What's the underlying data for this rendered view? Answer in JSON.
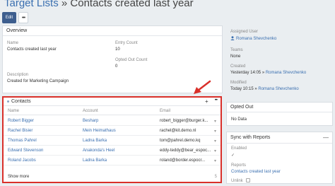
{
  "header": {
    "breadcrumb_link": "Target Lists",
    "breadcrumb_sep": " » ",
    "title": "Contacts created last year",
    "edit_label": "Edit",
    "more_label": "•••"
  },
  "overview": {
    "heading": "Overview",
    "name_label": "Name",
    "name_value": "Contacts created last year",
    "entry_count_label": "Entry Count",
    "entry_count_value": "10",
    "opted_out_count_label": "Opted Out Count",
    "opted_out_count_value": "0",
    "description_label": "Description",
    "description_value": "Created for Marketing Campaign"
  },
  "contacts": {
    "heading": "Contacts",
    "add_icon": "+",
    "more_icon": "•••",
    "columns": [
      "Name",
      "Account",
      "Email"
    ],
    "rows": [
      {
        "name": "Robert Bigger",
        "account": "Besharp",
        "email": "robert_bigger@burger.k..."
      },
      {
        "name": "Rachel Bisier",
        "account": "Mein Heimathaus",
        "email": "rachel@kit.demo.nl"
      },
      {
        "name": "Thomas Pahrel",
        "account": "Ladna Barka",
        "email": "tom@pahrel.demo.kq"
      },
      {
        "name": "Edward Stevenson",
        "account": "Anakonda's Heel",
        "email": "eddy-teddy@bear_espoc..."
      },
      {
        "name": "Roland Jacobs",
        "account": "Ladna Barka",
        "email": "roland@border.espocr..."
      }
    ],
    "show_more": "Show more",
    "remaining": "5"
  },
  "sidebar": {
    "assigned_user_label": "Assigned User",
    "assigned_user_value": "Romana Shevchenko",
    "teams_label": "Teams",
    "teams_value": "None",
    "created_label": "Created",
    "created_date": "Yesterday 14:05",
    "created_sep": " » ",
    "created_user": "Romana Shevchenko",
    "modified_label": "Modified",
    "modified_date": "Today 10:15",
    "modified_sep": " » ",
    "modified_user": "Romana Shevchenko"
  },
  "opted_out": {
    "heading": "Opted Out",
    "value": "No Data"
  },
  "sync": {
    "heading": "Sync with Reports",
    "collapse_icon": "—",
    "enabled_label": "Enabled",
    "enabled_check": "✓",
    "reports_label": "Reports",
    "reports_value": "Contacts created last year",
    "unlink_label": "Unlink"
  },
  "colors": {
    "accent": "#3d5e8e",
    "link": "#3a6fb0",
    "highlight": "#d9302a"
  }
}
